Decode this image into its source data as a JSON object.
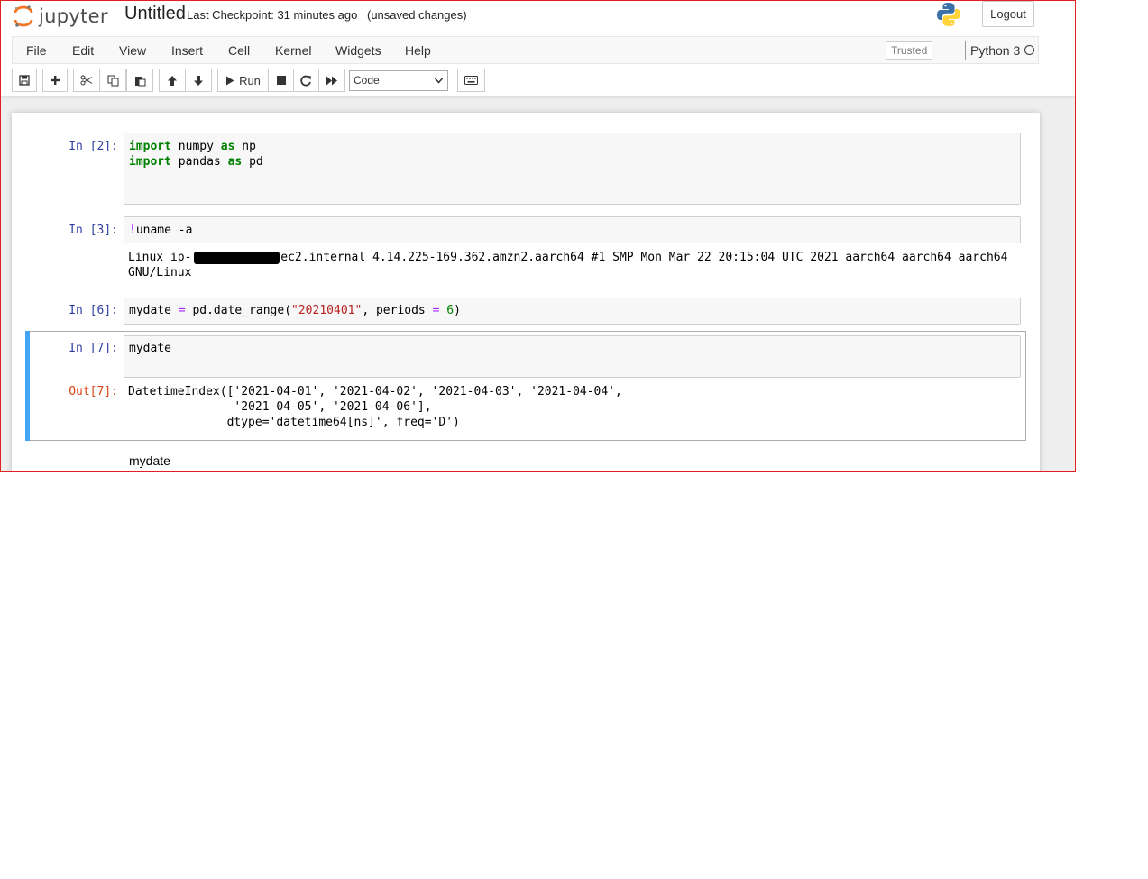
{
  "header": {
    "logo_text": "jupyter",
    "notebook_title": "Untitled",
    "checkpoint": "Last Checkpoint: 31 minutes ago",
    "unsaved": "(unsaved changes)",
    "logout_label": "Logout"
  },
  "menu": {
    "items": [
      "File",
      "Edit",
      "View",
      "Insert",
      "Cell",
      "Kernel",
      "Widgets",
      "Help"
    ],
    "trusted": "Trusted",
    "kernel_name": "Python 3"
  },
  "toolbar": {
    "run_label": "Run",
    "cell_type": "Code"
  },
  "cells": [
    {
      "prompt": "In [2]:",
      "lines": [
        "import numpy as np",
        "import pandas as pd"
      ]
    },
    {
      "prompt": "In [3]:",
      "lines": [
        "!uname -a"
      ],
      "output_lines": [
        "Linux ip-",
        ".ec2.internal 4.14.225-169.362.amzn2.aarch64 #1 SMP Mon Mar 22 20:15:04 UTC 2021 aarch64 aarch64 aarch64",
        "GNU/Linux"
      ]
    },
    {
      "prompt": "In [6]:",
      "lines": [
        "mydate = pd.date_range(\"20210401\", periods = 6)"
      ]
    },
    {
      "prompt": "In [7]:",
      "lines": [
        "mydate"
      ],
      "out_prompt": "Out[7]:",
      "output_lines": [
        "DatetimeIndex(['2021-04-01', '2021-04-02', '2021-04-03', '2021-04-04',",
        "               '2021-04-05', '2021-04-06'],",
        "              dtype='datetime64[ns]', freq='D')"
      ]
    }
  ],
  "markdown_cell": {
    "text": "mydate"
  },
  "colors": {
    "prompt_in": "#303f9f",
    "prompt_out": "#d84315",
    "selected_bar": "#42a5f5",
    "keyword": "#008000",
    "string": "#ba2121",
    "operator": "#aa22ff"
  }
}
